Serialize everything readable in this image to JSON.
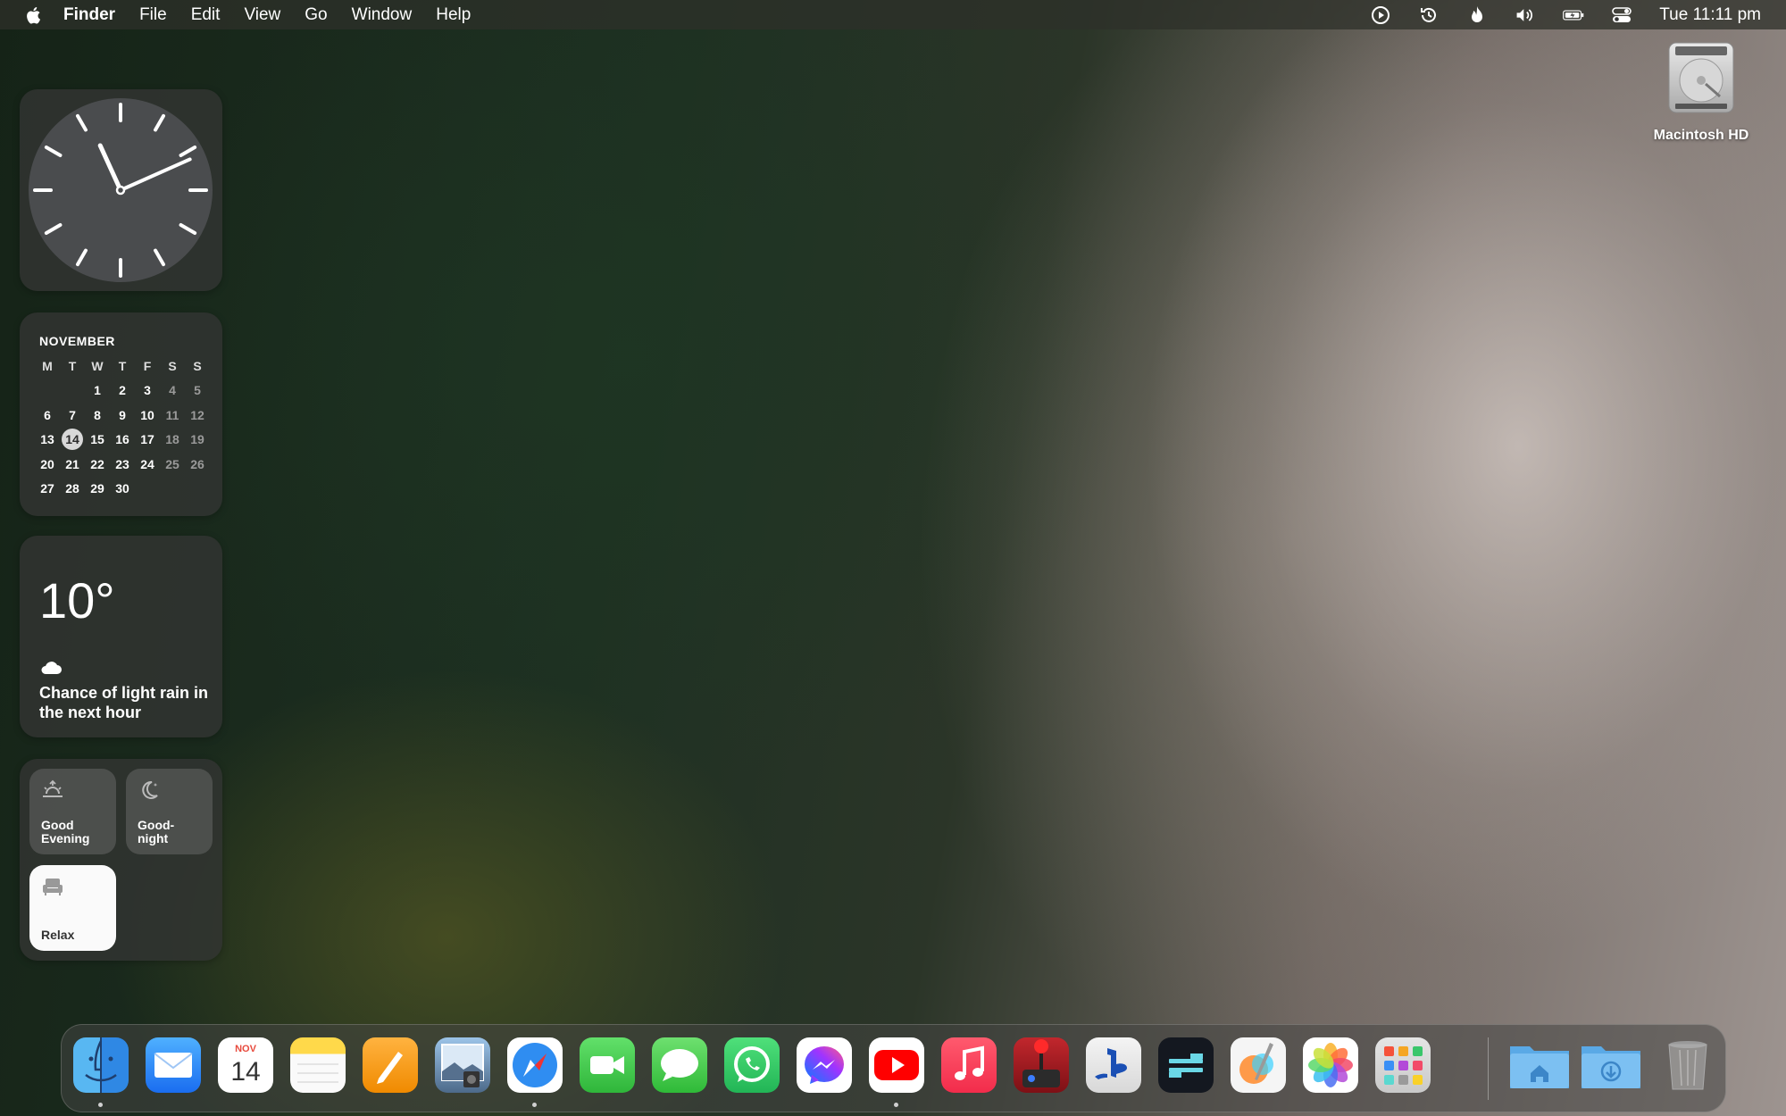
{
  "menubar": {
    "app_name": "Finder",
    "menus": [
      "File",
      "Edit",
      "View",
      "Go",
      "Window",
      "Help"
    ],
    "status_icons": [
      "play-circle-icon",
      "time-machine-icon",
      "flame-icon",
      "volume-icon",
      "battery-icon",
      "control-center-icon"
    ],
    "clock": "Tue 11:11 pm"
  },
  "calendar_widget": {
    "month": "NOVEMBER",
    "weekdays": [
      "M",
      "T",
      "W",
      "T",
      "F",
      "S",
      "S"
    ],
    "weeks": [
      [
        "",
        "",
        "1",
        "2",
        "3",
        "4",
        "5"
      ],
      [
        "6",
        "7",
        "8",
        "9",
        "10",
        "11",
        "12"
      ],
      [
        "13",
        "14",
        "15",
        "16",
        "17",
        "18",
        "19"
      ],
      [
        "20",
        "21",
        "22",
        "23",
        "24",
        "25",
        "26"
      ],
      [
        "27",
        "28",
        "29",
        "30",
        "",
        "",
        ""
      ]
    ],
    "today": "14"
  },
  "clock_widget": {
    "hour": 11,
    "minute": 11
  },
  "weather_widget": {
    "temperature": "10°",
    "condition_icon": "cloud-icon",
    "description": "Chance of light rain in the next hour"
  },
  "home_widget": {
    "scenes": [
      {
        "label": "Good Evening",
        "icon": "sunset-icon"
      },
      {
        "label": "Good-night",
        "icon": "moon-icon"
      },
      {
        "label": "Relax",
        "icon": "armchair-icon"
      }
    ]
  },
  "desktop": {
    "items": [
      {
        "label": "Macintosh HD",
        "icon": "hard-drive-icon"
      }
    ]
  },
  "dock": {
    "apps": [
      {
        "icon": "finder-icon",
        "running": true
      },
      {
        "icon": "mail-icon",
        "running": false
      },
      {
        "icon": "calendar-icon",
        "running": false,
        "month": "NOV",
        "day": "14"
      },
      {
        "icon": "notes-icon",
        "running": false
      },
      {
        "icon": "pages-icon",
        "running": false
      },
      {
        "icon": "preview-icon",
        "running": false
      },
      {
        "icon": "safari-icon",
        "running": true
      },
      {
        "icon": "facetime-icon",
        "running": false
      },
      {
        "icon": "messages-icon",
        "running": false
      },
      {
        "icon": "whatsapp-icon",
        "running": false
      },
      {
        "icon": "messenger-icon",
        "running": false
      },
      {
        "icon": "youtube-icon",
        "running": true
      },
      {
        "icon": "music-icon",
        "running": false
      },
      {
        "icon": "joystick-icon",
        "running": false
      },
      {
        "icon": "playstation-icon",
        "running": false
      },
      {
        "icon": "terminal-app-icon",
        "running": false
      },
      {
        "icon": "pixelmator-icon",
        "running": false
      },
      {
        "icon": "photos-icon",
        "running": false
      },
      {
        "icon": "launchpad-icon",
        "running": false
      }
    ],
    "folders": [
      {
        "icon": "home-folder-icon"
      },
      {
        "icon": "downloads-folder-icon"
      },
      {
        "icon": "trash-icon"
      }
    ]
  },
  "colors": {
    "menubar_bg": "#2d302a",
    "today_highlight": "#d8d8d8",
    "widget_bg": "#323432"
  }
}
